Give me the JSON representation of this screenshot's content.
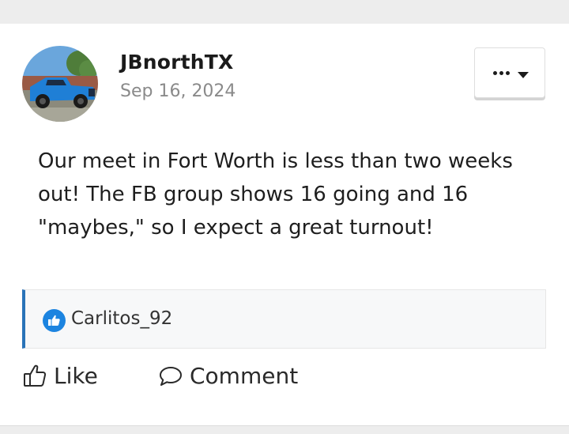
{
  "post": {
    "author": "JBnorthTX",
    "date": "Sep 16, 2024",
    "body": "Our meet in Fort Worth is less than two weeks out! The FB group shows 16 going and 16 \"maybes,\" so I expect a great turnout!",
    "avatar_icon": "blue-pickup-truck-photo"
  },
  "options": {
    "icon": "more-dots-icon",
    "caret_icon": "caret-down-icon"
  },
  "reactions": {
    "icon": "like-reaction-icon",
    "users": "Carlitos_92",
    "accent_color": "#2a73b8"
  },
  "actions": {
    "like_label": "Like",
    "like_icon": "thumbs-up-icon",
    "comment_label": "Comment",
    "comment_icon": "speech-bubble-icon"
  }
}
